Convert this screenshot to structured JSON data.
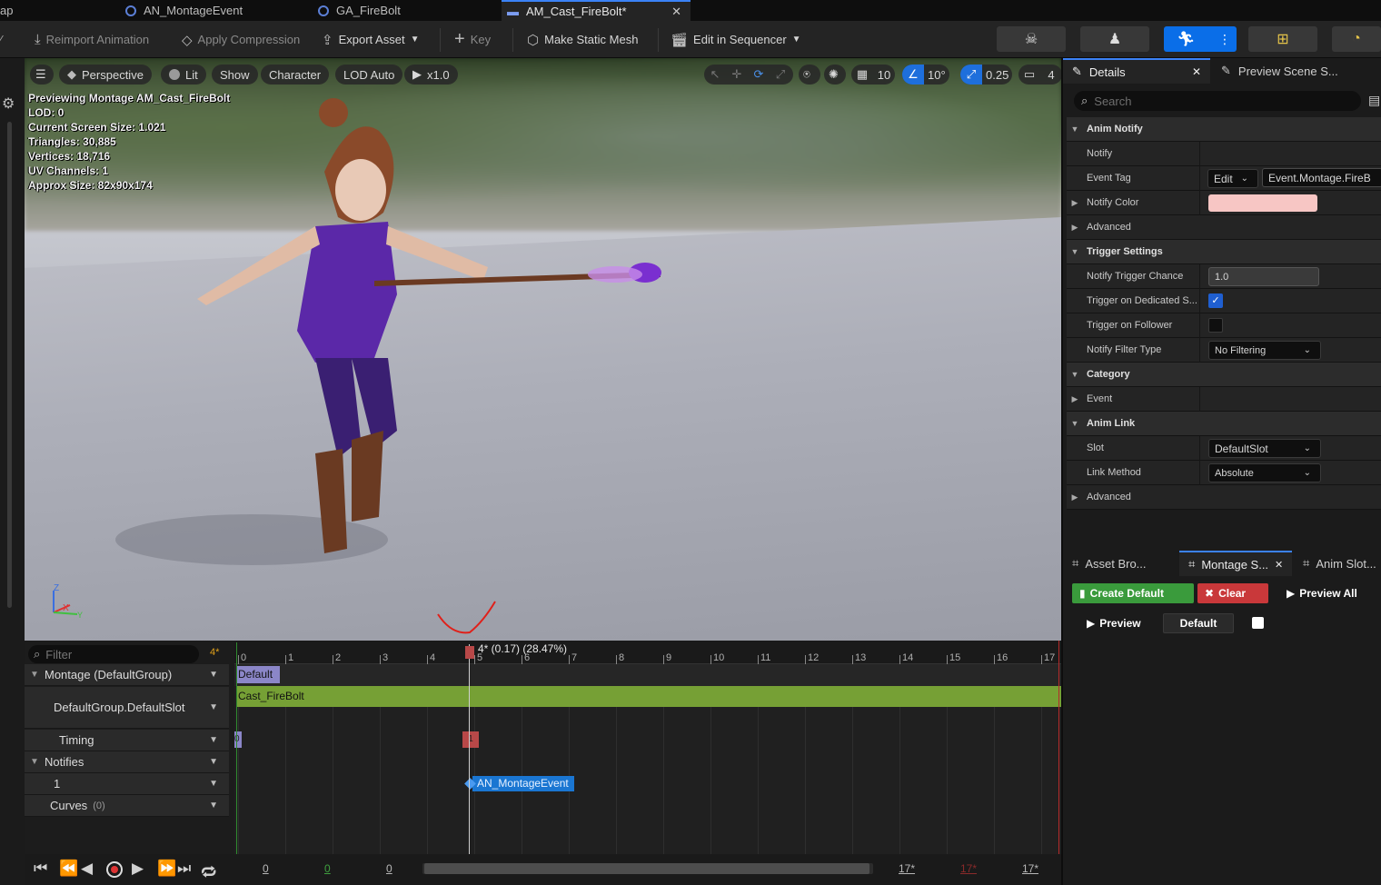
{
  "tabs": [
    {
      "label": "ap"
    },
    {
      "label": "AN_MontageEvent"
    },
    {
      "label": "GA_FireBolt"
    },
    {
      "label": "AM_Cast_FireBolt*",
      "active": true
    }
  ],
  "toolbar": {
    "reimport": "Reimport Animation",
    "compression": "Apply Compression",
    "export": "Export Asset",
    "key": "Key",
    "static_mesh": "Make Static Mesh",
    "sequencer": "Edit in Sequencer"
  },
  "viewport": {
    "perspective": "Perspective",
    "lit": "Lit",
    "show": "Show",
    "character": "Character",
    "lod": "LOD Auto",
    "speed": "x1.0",
    "grid": "10",
    "angle": "10°",
    "scale": "0.25",
    "cam": "4",
    "stats": [
      "Previewing Montage AM_Cast_FireBolt",
      "LOD: 0",
      "Current Screen Size: 1.021",
      "Triangles: 30,885",
      "Vertices: 18,716",
      "UV Channels: 1",
      "Approx Size: 82x90x174"
    ],
    "axis": {
      "z": "Z",
      "x": "X",
      "y": "Y"
    }
  },
  "timeline": {
    "filter_placeholder": "Filter",
    "frame_badge": "4*",
    "rows": {
      "montage": "Montage (DefaultGroup)",
      "slot": "DefaultGroup.DefaultSlot",
      "timing": "Timing",
      "notifies": "Notifies",
      "notify_track": "1",
      "curves": "Curves",
      "curves_count": "(0)"
    },
    "ruler_labels": [
      "0",
      "1",
      "2",
      "3",
      "4",
      "5",
      "6",
      "7",
      "8",
      "9",
      "10",
      "11",
      "12",
      "13",
      "14",
      "15",
      "16",
      "17"
    ],
    "playhead_label": "4* (0.17) (28.47%)",
    "section_label": "Default",
    "segment_label": "Cast_FireBolt",
    "timing_marker_0": "0",
    "timing_marker_1": "1",
    "notify_label": "AN_MontageEvent",
    "transport_nums": [
      "0",
      "0",
      "0",
      "17*",
      "17*",
      "17*"
    ]
  },
  "details": {
    "tab_details": "Details",
    "tab_preview": "Preview Scene S...",
    "search_placeholder": "Search",
    "sections": {
      "anim_notify": "Anim Notify",
      "notify": "Notify",
      "event_tag": "Event Tag",
      "edit": "Edit",
      "event_tag_value": "Event.Montage.FireB",
      "notify_color": "Notify Color",
      "advanced1": "Advanced",
      "trigger_settings": "Trigger Settings",
      "trigger_chance": "Notify Trigger Chance",
      "trigger_chance_value": "1.0",
      "trigger_dedicated": "Trigger on Dedicated S...",
      "trigger_follower": "Trigger on Follower",
      "filter_type": "Notify Filter Type",
      "filter_type_value": "No Filtering",
      "category": "Category",
      "event": "Event",
      "anim_link": "Anim Link",
      "slot": "Slot",
      "slot_value": "DefaultSlot",
      "link_method": "Link Method",
      "link_method_value": "Absolute",
      "advanced2": "Advanced"
    },
    "notify_color_hex": "#f7c6c4"
  },
  "slots": {
    "tab_asset": "Asset Bro...",
    "tab_montage": "Montage S...",
    "tab_anim_slot": "Anim Slot...",
    "create_default": "Create Default",
    "clear": "Clear",
    "preview_all": "Preview All",
    "preview": "Preview",
    "default": "Default"
  },
  "colors": {
    "accent": "#0a6ee8",
    "segment_green": "#76a035",
    "notify_blue": "#1a76d2",
    "create_green": "#3a9b3c",
    "clear_red": "#c9383a"
  }
}
